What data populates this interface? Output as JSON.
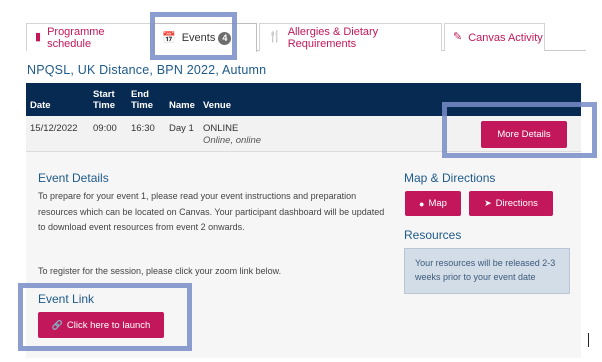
{
  "tabs": [
    {
      "label": "Programme schedule",
      "icon": "book-icon",
      "active": false
    },
    {
      "label": "Events",
      "icon": "calendar-icon",
      "active": true,
      "badge": "4"
    },
    {
      "label": "Allergies & Dietary Requirements",
      "icon": "utensils-icon",
      "active": false
    },
    {
      "label": "Canvas Activity",
      "icon": "pencil-icon",
      "active": false
    }
  ],
  "heading": "NPQSL, UK Distance, BPN 2022, Autumn",
  "table": {
    "headers": {
      "date": "Date",
      "start_a": "Start",
      "start_b": "Time",
      "end_a": "End",
      "end_b": "Time",
      "name": "Name",
      "venue": "Venue"
    },
    "row": {
      "date": "15/12/2022",
      "start": "09:00",
      "end": "16:30",
      "name": "Day 1",
      "venue": "ONLINE",
      "venue_sub": "Online, online",
      "button": "More Details"
    }
  },
  "event_details": {
    "title": "Event Details",
    "para1_line1": "To prepare for your event 1, please read your event instructions and preparation",
    "para1_line2": "resources which can be located on Canvas. Your participant dashboard will be updated",
    "para1_line3": "to download event resources from event 2 onwards.",
    "para2": "To register for the session, please click your zoom link below."
  },
  "event_link": {
    "title": "Event Link",
    "button": "Click here to launch"
  },
  "map": {
    "title": "Map & Directions",
    "map_button": "Map",
    "directions_button": "Directions"
  },
  "resources": {
    "title": "Resources",
    "line1": "Your resources will be released 2-3",
    "line2": "weeks prior to your event date"
  },
  "colors": {
    "accent": "#c2185b",
    "header_bg": "#072a52",
    "title_blue": "#1e5a8a",
    "highlight": "#788cc8"
  }
}
